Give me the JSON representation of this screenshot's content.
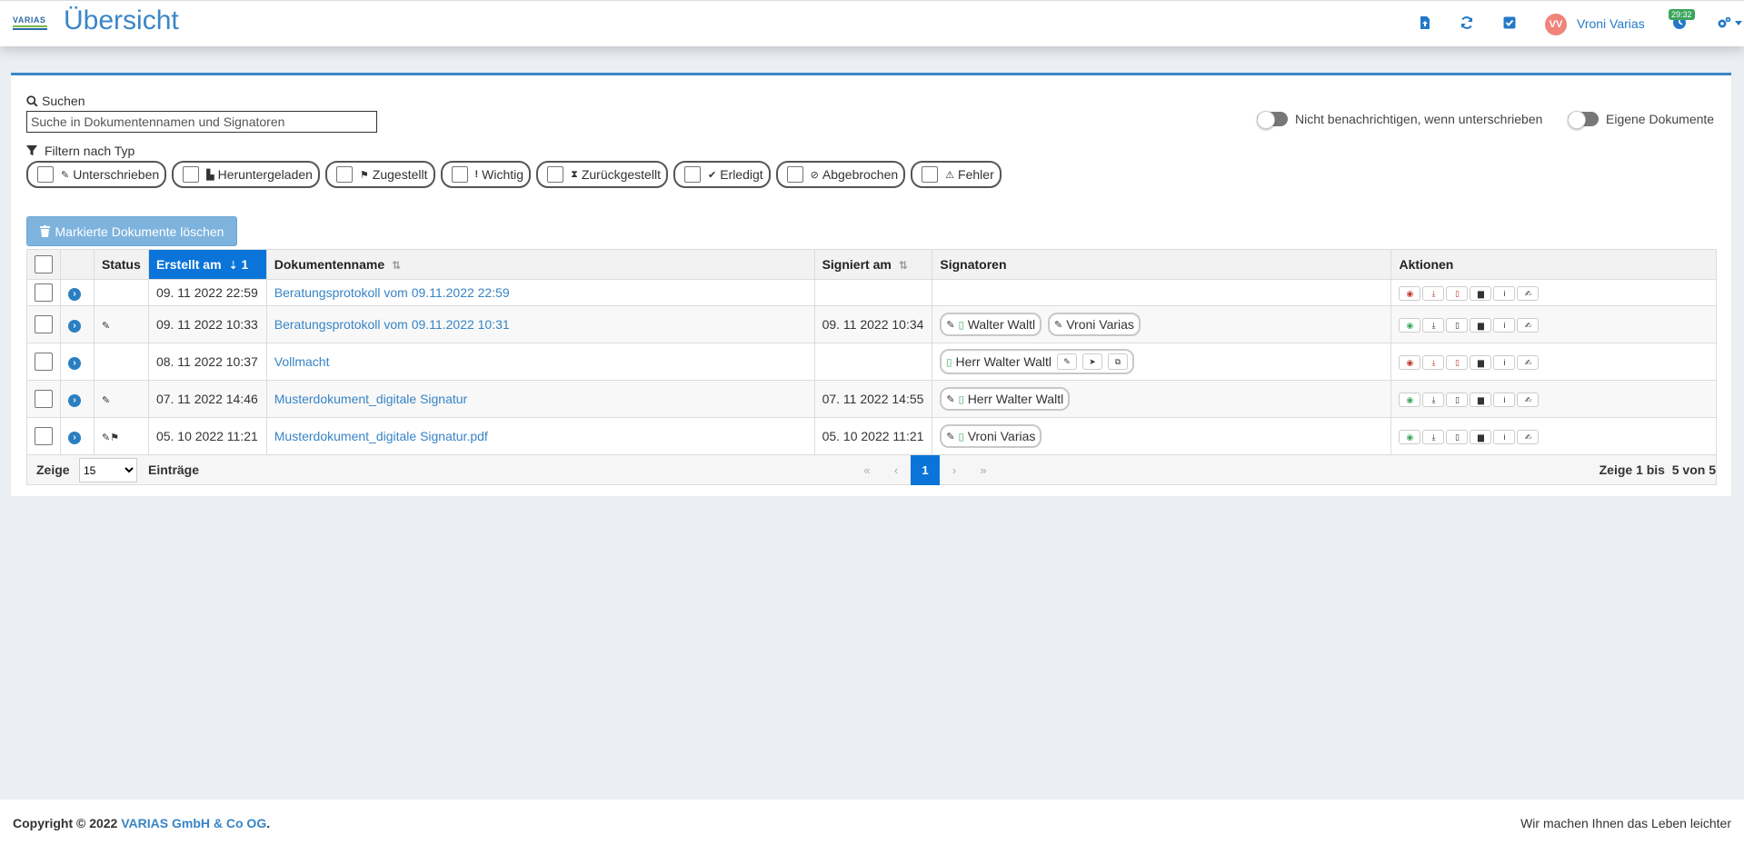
{
  "header": {
    "logo_text": "VARIAS",
    "title": "Übersicht",
    "icons": [
      "upload-file-icon",
      "refresh-icon",
      "checkbox-icon",
      "clock-icon",
      "settings-icon"
    ],
    "user_initials": "VV",
    "user_name": "Vroni Varias",
    "timer": "29:32"
  },
  "search": {
    "label": "Suchen",
    "placeholder": "Suche in Dokumentennamen und Signatoren"
  },
  "toggles": {
    "notify_label": "Nicht benachrichtigen, wenn unterschrieben",
    "own_label": "Eigene Dokumente"
  },
  "filter": {
    "label": "Filtern nach Typ",
    "chips": [
      {
        "icon": "✎",
        "label": "Unterschrieben"
      },
      {
        "icon": "▙",
        "label": "Heruntergeladen"
      },
      {
        "icon": "⚑",
        "label": "Zugestellt"
      },
      {
        "icon": "!",
        "label": "Wichtig"
      },
      {
        "icon": "⧗",
        "label": "Zurückgestellt"
      },
      {
        "icon": "✔",
        "label": "Erledigt"
      },
      {
        "icon": "⊘",
        "label": "Abgebrochen"
      },
      {
        "icon": "⚠",
        "label": "Fehler"
      }
    ]
  },
  "delete_button": "Markierte Dokumente löschen",
  "table": {
    "columns": {
      "status": "Status",
      "created": "Erstellt am",
      "created_sort_order": "1",
      "name": "Dokumentenname",
      "signed": "Signiert am",
      "signers": "Signatoren",
      "actions": "Aktionen"
    },
    "rows": [
      {
        "status": "",
        "created": "09. 11 2022 22:59",
        "name": "Beratungsprotokoll vom 09.11.2022 22:59",
        "signed": "",
        "signers": []
      },
      {
        "status": "✎",
        "created": "09. 11 2022 10:33",
        "name": "Beratungsprotokoll vom 09.11.2022 10:31",
        "signed": "09. 11 2022 10:34",
        "signers": [
          "Walter Waltl",
          "Vroni Varias"
        ]
      },
      {
        "status": "",
        "created": "08. 11 2022 10:37",
        "name": "Vollmacht",
        "signed": "",
        "signers": [
          "Herr Walter Waltl"
        ]
      },
      {
        "status": "✎",
        "created": "07. 11 2022 14:46",
        "name": "Musterdokument_digitale Signatur",
        "signed": "07. 11 2022 14:55",
        "signers": [
          "Herr Walter Waltl"
        ]
      },
      {
        "status": "✎⚑",
        "created": "05. 10 2022 11:21",
        "name": "Musterdokument_digitale Signatur.pdf",
        "signed": "05. 10 2022 11:21",
        "signers": [
          "Vroni Varias"
        ]
      }
    ]
  },
  "table_footer": {
    "show": "Zeige",
    "page_length": "15",
    "entries": "Einträge",
    "pager": {
      "first": "«",
      "prev": "‹",
      "current": "1",
      "next": "›",
      "last": "»"
    },
    "info": "Zeige 1 bis  5 von 5"
  },
  "footer": {
    "copyright_prefix": "Copyright © 2022 ",
    "company": "VARIAS GmbH & Co OG",
    "copyright_suffix": ".",
    "slogan": "Wir machen Ihnen das Leben leichter"
  },
  "colors": {
    "accent": "#0b74d9",
    "link": "#3784c6",
    "background": "#ebeef3"
  }
}
